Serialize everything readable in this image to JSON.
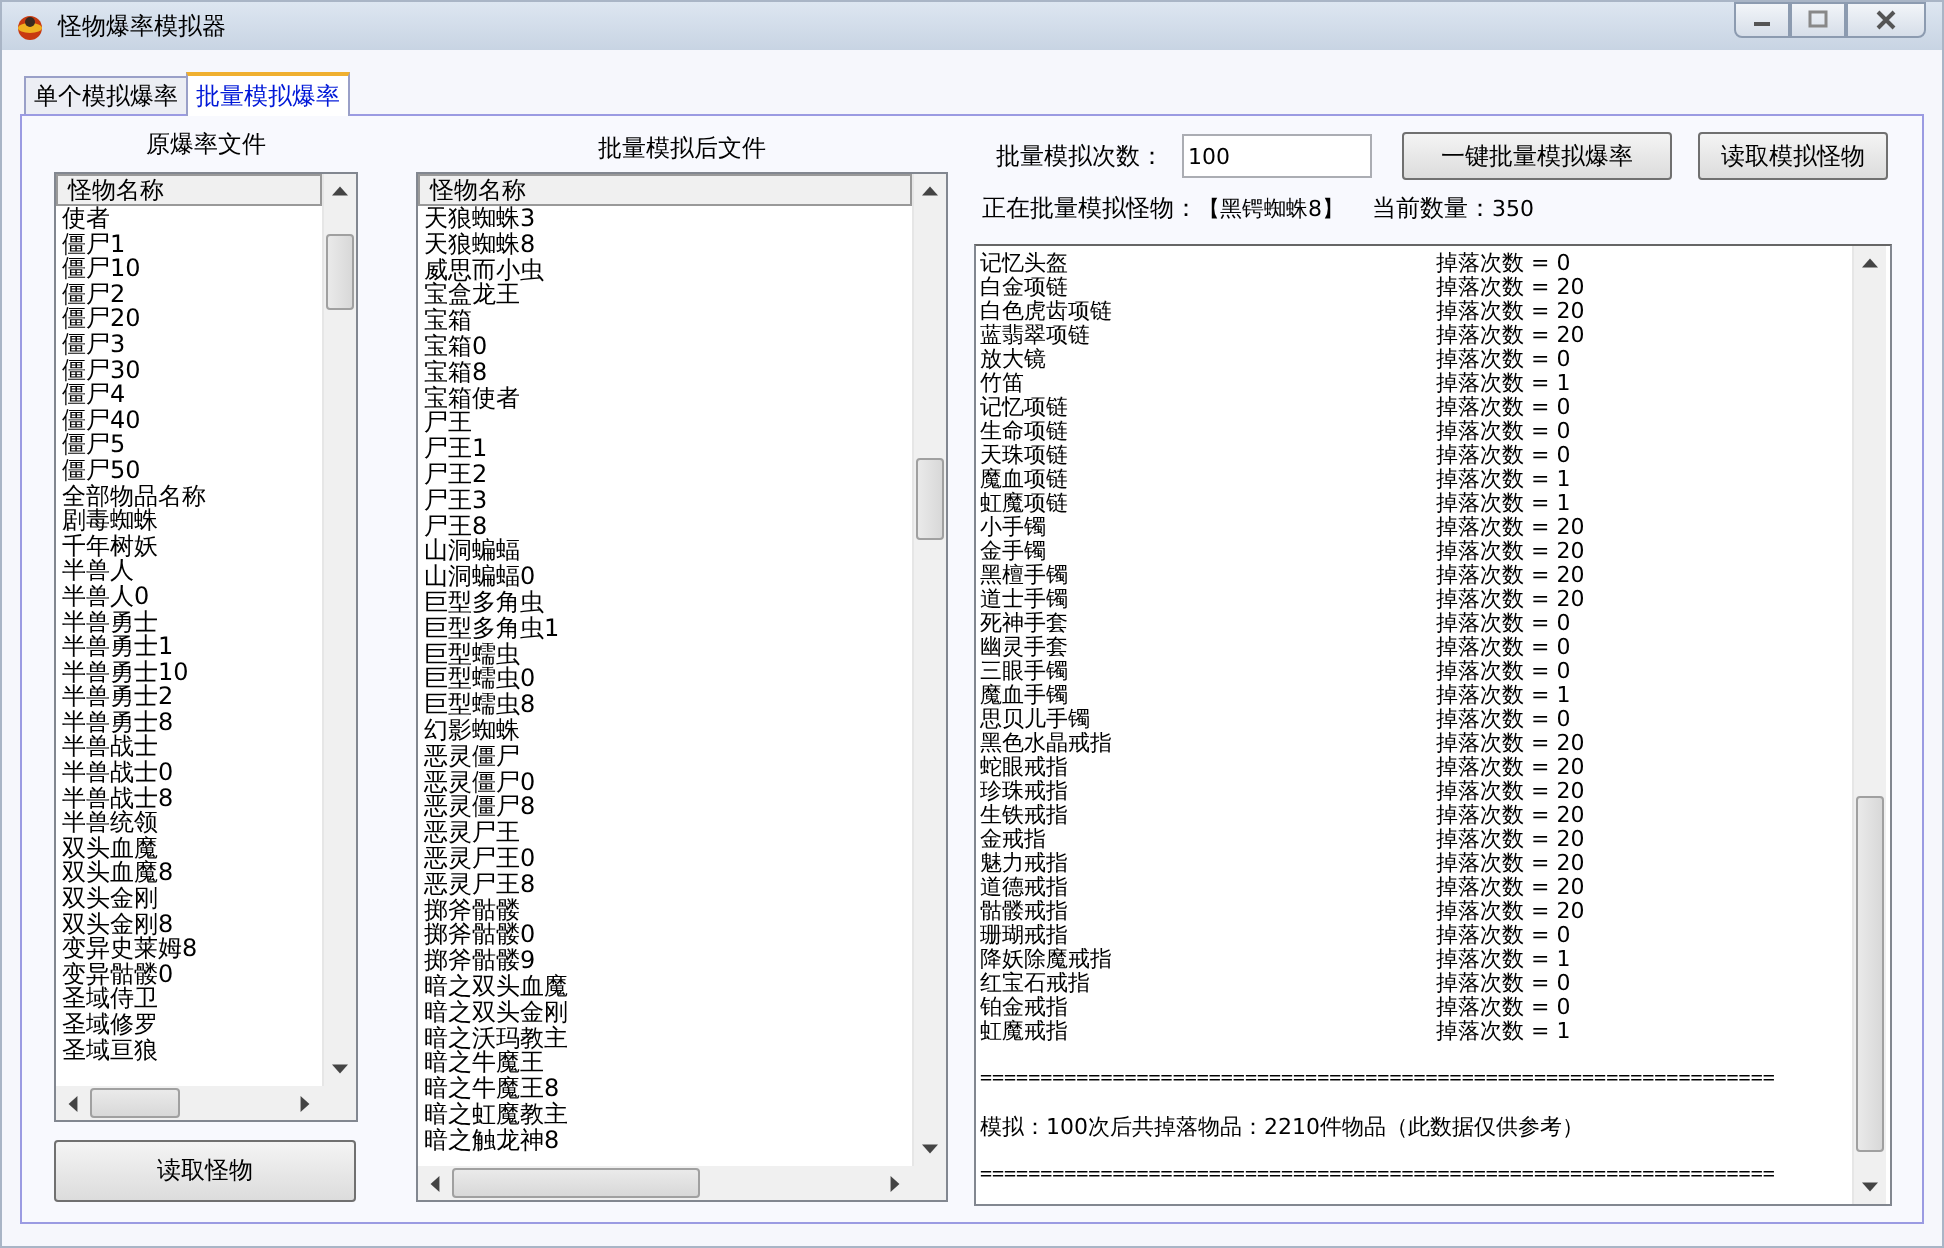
{
  "window": {
    "title": "怪物爆率模拟器"
  },
  "tabs": [
    {
      "label": "单个模拟爆率",
      "selected": false
    },
    {
      "label": "批量模拟爆率",
      "selected": true
    }
  ],
  "original_file": {
    "label": "原爆率文件",
    "column": "怪物名称",
    "rows": [
      "使者",
      "僵尸1",
      "僵尸10",
      "僵尸2",
      "僵尸20",
      "僵尸3",
      "僵尸30",
      "僵尸4",
      "僵尸40",
      "僵尸5",
      "僵尸50",
      "全部物品名称",
      "剧毒蜘蛛",
      "千年树妖",
      "半兽人",
      "半兽人0",
      "半兽勇士",
      "半兽勇士1",
      "半兽勇士10",
      "半兽勇士2",
      "半兽勇士8",
      "半兽战士",
      "半兽战士0",
      "半兽战士8",
      "半兽统领",
      "双头血魔",
      "双头血魔8",
      "双头金刚",
      "双头金刚8",
      "变异史莱姆8",
      "变异骷髅0",
      "圣域侍卫",
      "圣域修罗",
      "圣域亘狼"
    ]
  },
  "read_button": "读取怪物",
  "simulated_file": {
    "label": "批量模拟后文件",
    "column": "怪物名称",
    "rows": [
      "天狼蜘蛛3",
      "天狼蜘蛛8",
      "威思而小虫",
      "宝盒龙王",
      "宝箱",
      "宝箱0",
      "宝箱8",
      "宝箱使者",
      "尸王",
      "尸王1",
      "尸王2",
      "尸王3",
      "尸王8",
      "山洞蝙蝠",
      "山洞蝙蝠0",
      "巨型多角虫",
      "巨型多角虫1",
      "巨型蠕虫",
      "巨型蠕虫0",
      "巨型蠕虫8",
      "幻影蜘蛛",
      "恶灵僵尸",
      "恶灵僵尸0",
      "恶灵僵尸8",
      "恶灵尸王",
      "恶灵尸王0",
      "恶灵尸王8",
      "掷斧骷髅",
      "掷斧骷髅0",
      "掷斧骷髅9",
      "暗之双头血魔",
      "暗之双头金刚",
      "暗之沃玛教主",
      "暗之牛魔王",
      "暗之牛魔王8",
      "暗之虹魔教主",
      "暗之触龙神8"
    ]
  },
  "batch_count": {
    "label": "批量模拟次数：",
    "value": "100"
  },
  "buttons": [
    "一键批量模拟爆率",
    "读取模拟怪物"
  ],
  "status": {
    "monster_label": "正在批量模拟怪物：",
    "monster": "【黑锷蜘蛛8】",
    "count_label": "当前数量：",
    "count": "350"
  },
  "results": [
    {
      "kind": "item",
      "name": "记忆头盔",
      "count": "掉落次数 = 0"
    },
    {
      "kind": "item",
      "name": "白金项链",
      "count": "掉落次数 = 20"
    },
    {
      "kind": "item",
      "name": "白色虎齿项链",
      "count": "掉落次数 = 20"
    },
    {
      "kind": "item",
      "name": "蓝翡翠项链",
      "count": "掉落次数 = 20"
    },
    {
      "kind": "item",
      "name": "放大镜",
      "count": "掉落次数 = 0"
    },
    {
      "kind": "item",
      "name": "竹笛",
      "count": "掉落次数 = 1"
    },
    {
      "kind": "item",
      "name": "记忆项链",
      "count": "掉落次数 = 0"
    },
    {
      "kind": "item",
      "name": "生命项链",
      "count": "掉落次数 = 0"
    },
    {
      "kind": "item",
      "name": "天珠项链",
      "count": "掉落次数 = 0"
    },
    {
      "kind": "item",
      "name": "魔血项链",
      "count": "掉落次数 = 1"
    },
    {
      "kind": "item",
      "name": "虹魔项链",
      "count": "掉落次数 = 1"
    },
    {
      "kind": "item",
      "name": "小手镯",
      "count": "掉落次数 = 20"
    },
    {
      "kind": "item",
      "name": "金手镯",
      "count": "掉落次数 = 20"
    },
    {
      "kind": "item",
      "name": "黑檀手镯",
      "count": "掉落次数 = 20"
    },
    {
      "kind": "item",
      "name": "道士手镯",
      "count": "掉落次数 = 20"
    },
    {
      "kind": "item",
      "name": "死神手套",
      "count": "掉落次数 = 0"
    },
    {
      "kind": "item",
      "name": "幽灵手套",
      "count": "掉落次数 = 0"
    },
    {
      "kind": "item",
      "name": "三眼手镯",
      "count": "掉落次数 = 0"
    },
    {
      "kind": "item",
      "name": "魔血手镯",
      "count": "掉落次数 = 1"
    },
    {
      "kind": "item",
      "name": "思贝儿手镯",
      "count": "掉落次数 = 0"
    },
    {
      "kind": "item",
      "name": "黑色水晶戒指",
      "count": "掉落次数 = 20"
    },
    {
      "kind": "item",
      "name": "蛇眼戒指",
      "count": "掉落次数 = 20"
    },
    {
      "kind": "item",
      "name": "珍珠戒指",
      "count": "掉落次数 = 20"
    },
    {
      "kind": "item",
      "name": "生铁戒指",
      "count": "掉落次数 = 20"
    },
    {
      "kind": "item",
      "name": "金戒指",
      "count": "掉落次数 = 20"
    },
    {
      "kind": "item",
      "name": "魅力戒指",
      "count": "掉落次数 = 20"
    },
    {
      "kind": "item",
      "name": "道德戒指",
      "count": "掉落次数 = 20"
    },
    {
      "kind": "item",
      "name": "骷髅戒指",
      "count": "掉落次数 = 20"
    },
    {
      "kind": "item",
      "name": "珊瑚戒指",
      "count": "掉落次数 = 0"
    },
    {
      "kind": "item",
      "name": "降妖除魔戒指",
      "count": "掉落次数 = 1"
    },
    {
      "kind": "item",
      "name": "红宝石戒指",
      "count": "掉落次数 = 0"
    },
    {
      "kind": "item",
      "name": "铂金戒指",
      "count": "掉落次数 = 0"
    },
    {
      "kind": "item",
      "name": "虹魔戒指",
      "count": "掉落次数 = 1"
    },
    {
      "kind": "blank"
    },
    {
      "kind": "separator",
      "text": "=================================================================="
    },
    {
      "kind": "blank"
    },
    {
      "kind": "summary",
      "text": "模拟：100次后共掉落物品：2210件物品（此数据仅供参考）"
    },
    {
      "kind": "blank"
    },
    {
      "kind": "separator",
      "text": "=================================================================="
    }
  ]
}
